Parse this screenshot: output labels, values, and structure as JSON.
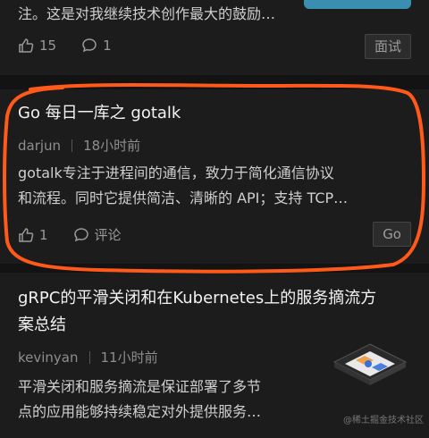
{
  "top_item": {
    "summary_tail": "注。这是对我继续技术创作最大的鼓励…",
    "likes": "15",
    "comments": "1",
    "tag": "面试"
  },
  "mid_item": {
    "title": "Go 每日一库之 gotalk",
    "author": "darjun",
    "time": "18小时前",
    "summary_line1": "gotalk专注于进程间的通信，致力于简化通信协议",
    "summary_line2": "和流程。同时它提供简洁、清晰的 API；支持 TCP…",
    "likes": "1",
    "comment_label": "评论",
    "tag": "Go"
  },
  "bottom_item": {
    "title_line1": "gRPC的平滑关闭和在Kubernetes上的服务摘流方",
    "title_line2": "案总结",
    "author": "kevinyan",
    "time": "11小时前",
    "summary_line1": "平滑关闭和服务摘流是保证部署了多节",
    "summary_line2": "点的应用能够持续稳定对外提供服务…"
  },
  "watermark": "@稀土掘金技术社区",
  "colors": {
    "annotation_outline": "#ff5a1a",
    "background": "#131313",
    "card": "#1c1c1c"
  }
}
